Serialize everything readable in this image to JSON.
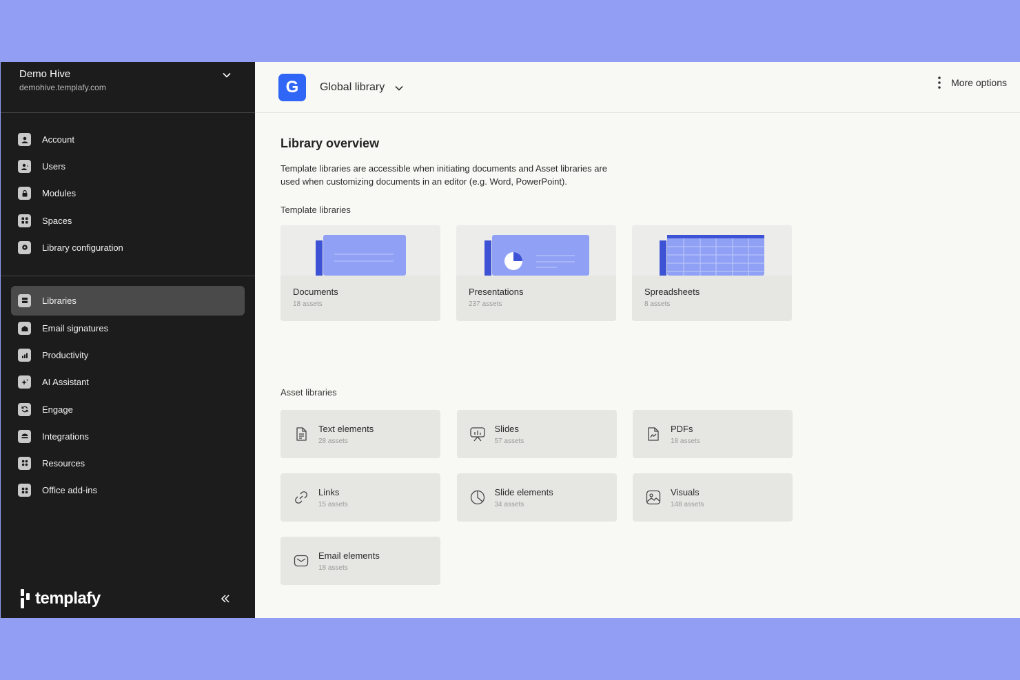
{
  "org": {
    "name": "Demo Hive",
    "domain": "demohive.templafy.com"
  },
  "nav_admin": [
    {
      "label": "Account",
      "icon": "user-icon"
    },
    {
      "label": "Users",
      "icon": "users-icon"
    },
    {
      "label": "Modules",
      "icon": "lock-icon"
    },
    {
      "label": "Spaces",
      "icon": "spaces-icon"
    },
    {
      "label": "Library configuration",
      "icon": "gear-icon"
    }
  ],
  "nav_main": [
    {
      "label": "Libraries",
      "icon": "libraries-icon",
      "active": true
    },
    {
      "label": "Email signatures",
      "icon": "email-signature-icon"
    },
    {
      "label": "Productivity",
      "icon": "chart-icon"
    },
    {
      "label": "AI Assistant",
      "icon": "sparkle-icon"
    },
    {
      "label": "Engage",
      "icon": "refresh-icon"
    },
    {
      "label": "Integrations",
      "icon": "integrations-icon"
    },
    {
      "label": "Resources",
      "icon": "grid-icon"
    },
    {
      "label": "Office add-ins",
      "icon": "addins-icon"
    }
  ],
  "brand": {
    "name": "templafy"
  },
  "topbar": {
    "logo_letter": "G",
    "title": "Global library",
    "more_label": "More options"
  },
  "content": {
    "title": "Library overview",
    "description": "Template libraries are accessible when initiating documents and Asset libraries are used when customizing documents in an editor (e.g. Word, PowerPoint).",
    "template_section": "Template libraries",
    "asset_section": "Asset libraries"
  },
  "template_libraries": [
    {
      "name": "Documents",
      "count": "18 assets"
    },
    {
      "name": "Presentations",
      "count": "237 assets"
    },
    {
      "name": "Spreadsheets",
      "count": "8 assets"
    }
  ],
  "asset_libraries": [
    {
      "name": "Text elements",
      "count": "28 assets",
      "icon": "text-document-icon"
    },
    {
      "name": "Slides",
      "count": "57 assets",
      "icon": "presentation-board-icon"
    },
    {
      "name": "PDFs",
      "count": "18 assets",
      "icon": "pdf-icon"
    },
    {
      "name": "Links",
      "count": "15 assets",
      "icon": "link-icon"
    },
    {
      "name": "Slide elements",
      "count": "34 assets",
      "icon": "pie-chart-icon"
    },
    {
      "name": "Visuals",
      "count": "148 assets",
      "icon": "image-icon"
    },
    {
      "name": "Email elements",
      "count": "18 assets",
      "icon": "envelope-icon"
    }
  ],
  "colors": {
    "accent": "#2f66f6",
    "sidebar": "#1c1c1c",
    "thumb_blue": "#8fa0f5",
    "thumb_dark": "#3d52d5",
    "backdrop": "#919ef3"
  }
}
